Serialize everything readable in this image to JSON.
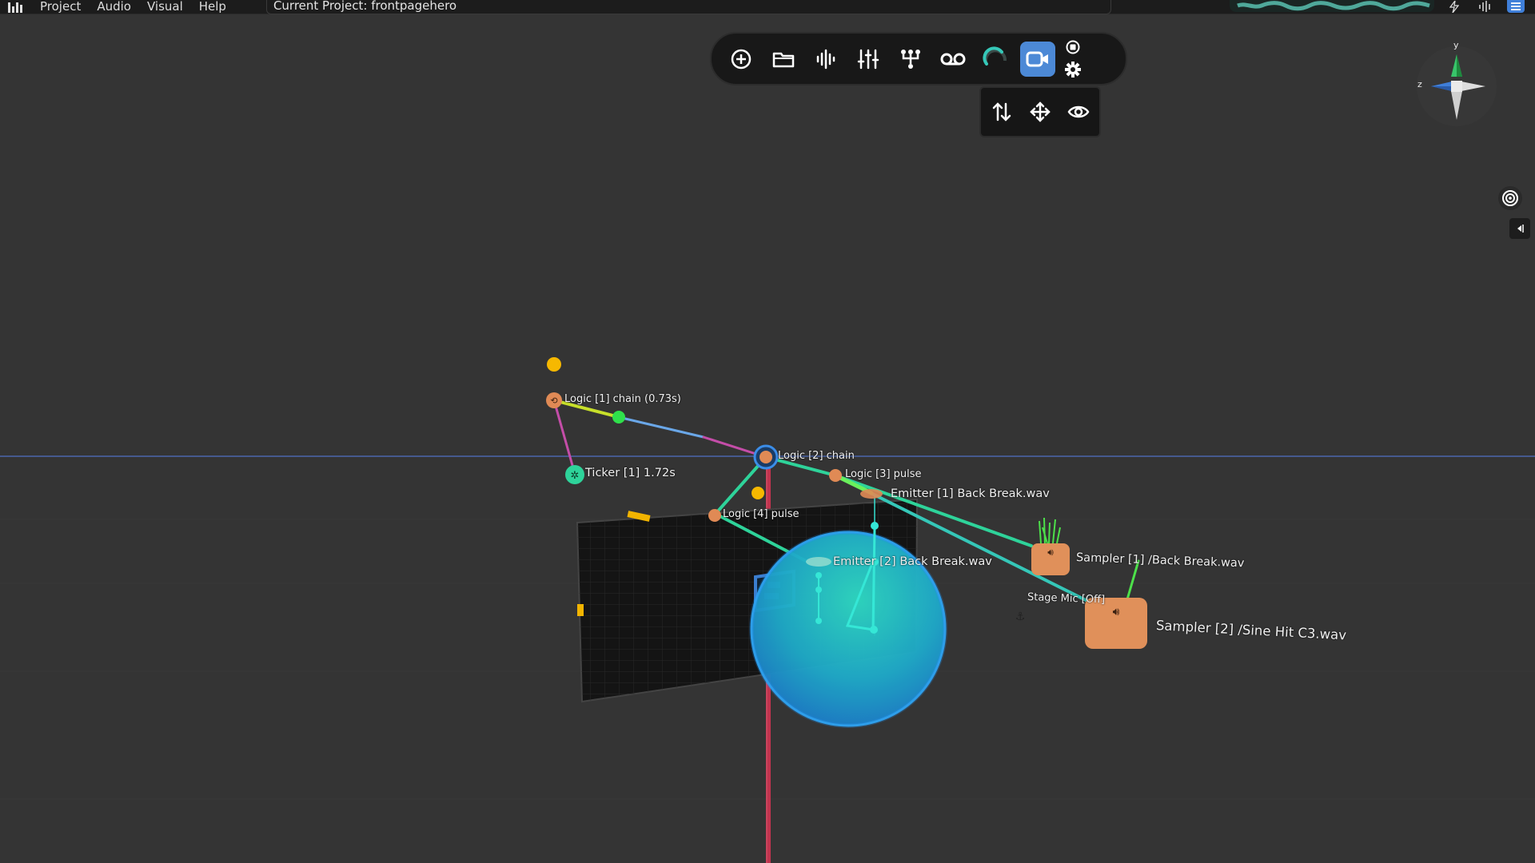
{
  "menubar": {
    "menus": [
      "Project",
      "Audio",
      "Visual",
      "Help"
    ],
    "project_label": "Current Project: frontpagehero",
    "icons": [
      "app-logo-icon",
      "lightning-icon",
      "audio-meter-icon",
      "hamburger-menu-icon"
    ]
  },
  "toolbar": {
    "buttons": [
      {
        "icon": "add-icon"
      },
      {
        "icon": "folder-icon"
      },
      {
        "icon": "waveform-icon"
      },
      {
        "icon": "mixer-sliders-icon"
      },
      {
        "icon": "node-graph-icon"
      },
      {
        "icon": "voicemail-icon"
      },
      {
        "icon": "loading-spinner-icon"
      },
      {
        "icon": "camera-icon",
        "active": true
      },
      {
        "icon": "record-stop-icon"
      },
      {
        "icon": "settings-gear-icon"
      }
    ],
    "sub_buttons": [
      {
        "icon": "up-down-arrows-icon"
      },
      {
        "icon": "move-arrows-icon"
      },
      {
        "icon": "eye-icon"
      }
    ]
  },
  "gizmo": {
    "y_label": "y",
    "z_label": "z"
  },
  "side_icons": [
    "target-icon",
    "collapse-panel-icon"
  ],
  "scene": {
    "labels": {
      "logic1": "Logic [1] chain (0.73s)",
      "ticker1": "Ticker [1] 1.72s",
      "logic2": "Logic [2] chain",
      "logic3": "Logic [3] pulse",
      "emitter1": "Emitter [1] Back Break.wav",
      "logic4": "Logic [4] pulse",
      "emitter2": "Emitter [2] Back Break.wav",
      "sampler1": "Sampler [1] /Back Break.wav",
      "stage_mic": "Stage Mic [Off]",
      "sampler2": "Sampler [2] /Sine Hit C3.wav"
    }
  },
  "colors": {
    "background": "#343434",
    "accent_blue": "#4c89d6",
    "node_orange": "#e08a55",
    "ticker_green": "#2ed39a",
    "sphere_cyan": "#22b9c8",
    "axis_red": "#c0344e",
    "horizon_blue": "#4f6fc4",
    "yellow_dot": "#f6b800"
  }
}
